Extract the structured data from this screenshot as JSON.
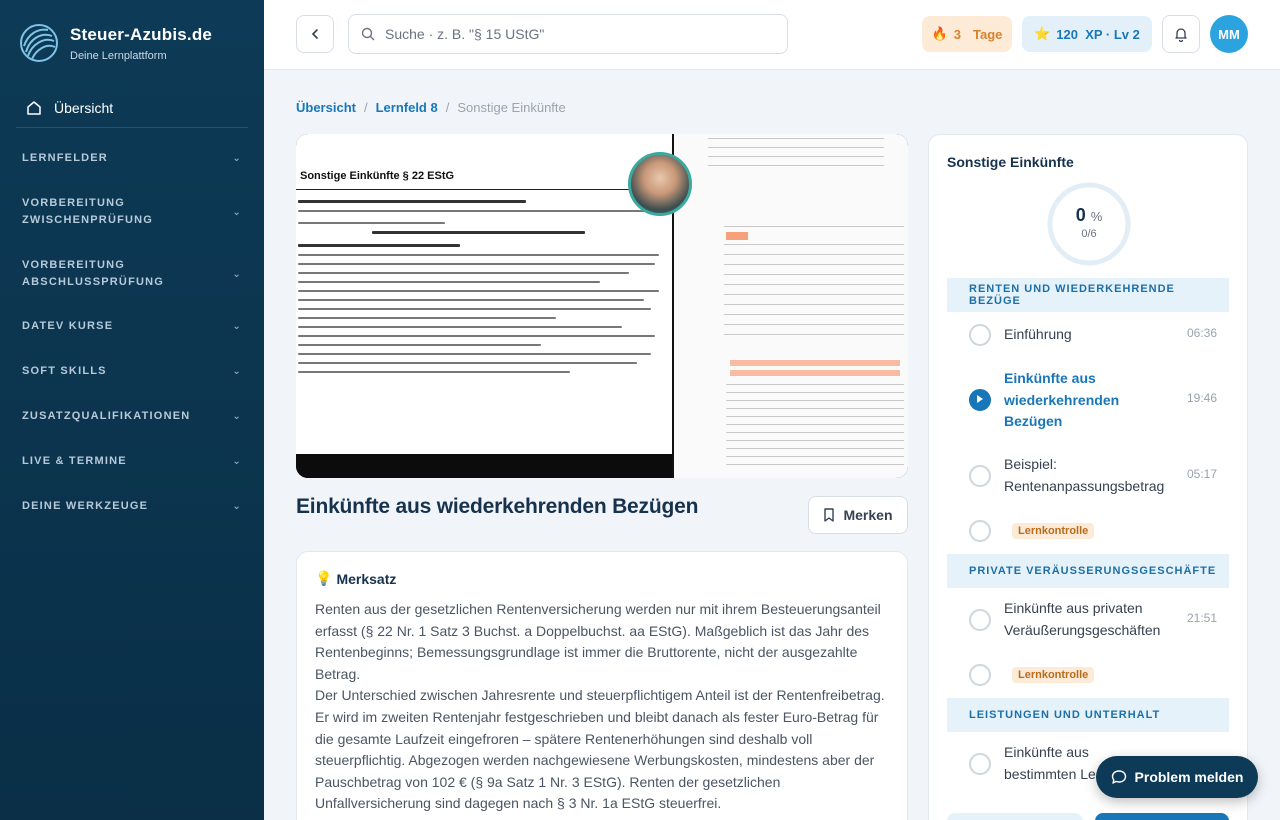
{
  "brand": {
    "title": "Steuer-Azubis.de",
    "subtitle": "Deine Lernplattform"
  },
  "sidebar": {
    "home_label": "Übersicht",
    "sections": [
      {
        "label": "LERNFELDER"
      },
      {
        "label": "VORBEREITUNG ZWISCHENPRÜFUNG"
      },
      {
        "label": "VORBEREITUNG ABSCHLUSSPRÜFUNG"
      },
      {
        "label": "DATEV KURSE"
      },
      {
        "label": "SOFT SKILLS"
      },
      {
        "label": "ZUSATZQUALIFIKATIONEN"
      },
      {
        "label": "LIVE & TERMINE"
      },
      {
        "label": "DEINE WERKZEUGE"
      }
    ]
  },
  "topbar": {
    "search_placeholder": "Suche · z. B. \"§ 15 UStG\"",
    "streak_value": "3",
    "streak_unit": "Tage",
    "xp_label": "120  XP · Lv 2",
    "avatar_initials": "MM"
  },
  "breadcrumb": {
    "items": [
      "Übersicht",
      "Lernfeld 8",
      "Sonstige Einkünfte"
    ],
    "separator": "/"
  },
  "video": {
    "doc_title": "Sonstige Einkünfte  § 22 EStG"
  },
  "lesson": {
    "title": "Einkünfte aus wiederkehrenden Bezügen",
    "bookmark_label": "Merken"
  },
  "merksatz": {
    "heading": "Merksatz",
    "paragraph_1": "Renten aus der gesetzlichen Rentenversicherung werden nur mit ihrem Besteuerungsanteil erfasst (§ 22 Nr. 1 Satz 3 Buchst. a Doppelbuchst. aa EStG). Maßgeblich ist das Jahr des Rentenbeginns; Bemessungsgrundlage ist immer die Bruttorente, nicht der ausgezahlte Betrag.",
    "paragraph_2": "Der Unterschied zwischen Jahresrente und steuerpflichtigem Anteil ist der Rentenfreibetrag. Er wird im zweiten Rentenjahr festgeschrieben und bleibt danach als fester Euro-Betrag für die gesamte Laufzeit eingefroren – spätere Rentenerhöhungen sind deshalb voll steuerpflichtig. Abgezogen werden nachgewiesene Werbungskosten, mindestens aber der Pauschbetrag von 102 € (§ 9a Satz 1 Nr. 3 EStG). Renten der gesetzlichen Unfallversicherung sind dagegen nach § 3 Nr. 1a EStG steuerfrei."
  },
  "panel": {
    "title": "Sonstige Einkünfte",
    "progress_percent": "0",
    "progress_unit": "%",
    "progress_count": "0/6",
    "progress_fraction": 0,
    "sections": [
      {
        "heading": "RENTEN UND WIEDERKEHRENDE BEZÜGE",
        "items": [
          {
            "label": "Einführung",
            "duration": "06:36"
          },
          {
            "label": "Einkünfte aus wiederkehrenden Bezügen",
            "duration": "19:46"
          },
          {
            "label": "Beispiel: Rentenanpassungsbetrag",
            "duration": "05:17"
          },
          {
            "badge": "Lernkontrolle"
          }
        ]
      },
      {
        "heading": "PRIVATE VERÄUSSERUNGSGESCHÄFTE",
        "items": [
          {
            "label": "Einkünfte aus privaten Veräußerungsgeschäften",
            "duration": "21:51"
          },
          {
            "badge": "Lernkontrolle"
          }
        ]
      },
      {
        "heading": "LEISTUNGEN UND UNTERHALT",
        "items": [
          {
            "label": "Einkünfte aus bestimmten Le"
          }
        ]
      }
    ]
  },
  "problem_button": {
    "label": "Problem melden"
  },
  "colors": {
    "sidebar": "#0d3a56",
    "accent": "#1877b8",
    "streak": "#d9822b",
    "badge_bg": "#fdebd8"
  }
}
